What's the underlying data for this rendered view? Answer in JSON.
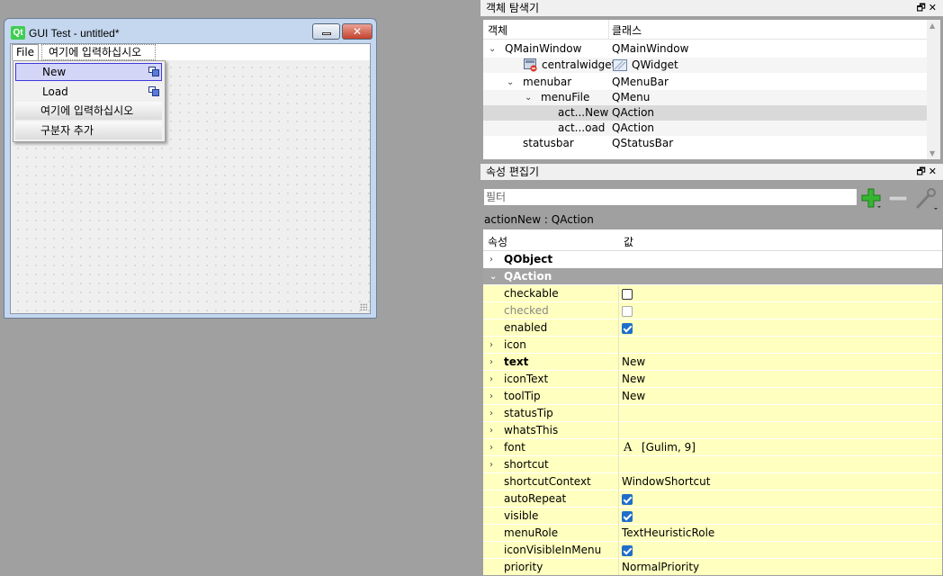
{
  "form_window": {
    "logo": "Qt",
    "title": "GUI Test - untitled*",
    "close_glyph": "✕",
    "menubar": {
      "file": "File",
      "placeholder": "여기에 입력하십시오"
    },
    "file_menu": [
      {
        "label": "New",
        "has_icon": true
      },
      {
        "label": "Load",
        "has_icon": true
      },
      {
        "label": "여기에 입력하십시오"
      },
      {
        "label": "구분자 추가"
      }
    ]
  },
  "object_inspector": {
    "title": "객체 탐색기",
    "headers": {
      "object": "객체",
      "class": "클래스"
    },
    "rows": [
      {
        "object": "QMainWindow",
        "class": "QMainWindow"
      },
      {
        "object": "centralwidget",
        "class": "QWidget"
      },
      {
        "object": "menubar",
        "class": "QMenuBar"
      },
      {
        "object": "menuFile",
        "class": "QMenu"
      },
      {
        "object": "act...New",
        "class": "QAction"
      },
      {
        "object": "act...oad",
        "class": "QAction"
      },
      {
        "object": "statusbar",
        "class": "QStatusBar"
      }
    ]
  },
  "property_editor": {
    "title": "속성 편집기",
    "filter_placeholder": "필터",
    "caption": "actionNew : QAction",
    "headers": {
      "property": "속성",
      "value": "값"
    },
    "groups": {
      "qobject": "QObject",
      "qaction": "QAction"
    },
    "rows": [
      {
        "name": "checkable",
        "checkbox": false
      },
      {
        "name": "checked",
        "checkbox": false
      },
      {
        "name": "enabled",
        "checkbox": true
      },
      {
        "name": "icon",
        "value": ""
      },
      {
        "name": "text",
        "value": "New"
      },
      {
        "name": "iconText",
        "value": "New"
      },
      {
        "name": "toolTip",
        "value": "New"
      },
      {
        "name": "statusTip",
        "value": ""
      },
      {
        "name": "whatsThis",
        "value": ""
      },
      {
        "name": "font",
        "value": "[Gulim, 9]",
        "font_glyph": "A"
      },
      {
        "name": "shortcut",
        "value": ""
      },
      {
        "name": "shortcutContext",
        "value": "WindowShortcut"
      },
      {
        "name": "autoRepeat",
        "checkbox": true
      },
      {
        "name": "visible",
        "checkbox": true
      },
      {
        "name": "menuRole",
        "value": "TextHeuristicRole"
      },
      {
        "name": "iconVisibleInMenu",
        "checkbox": true
      },
      {
        "name": "priority",
        "value": "NormalPriority"
      }
    ]
  },
  "colors": {
    "canvas_bg": "#a0a0a0",
    "property_row_bg": "#ffffbf",
    "group_header_bg": "#a3a3a3",
    "menu_highlight": "#d4d6f7",
    "checkbox_checked": "#1f6ec9"
  }
}
